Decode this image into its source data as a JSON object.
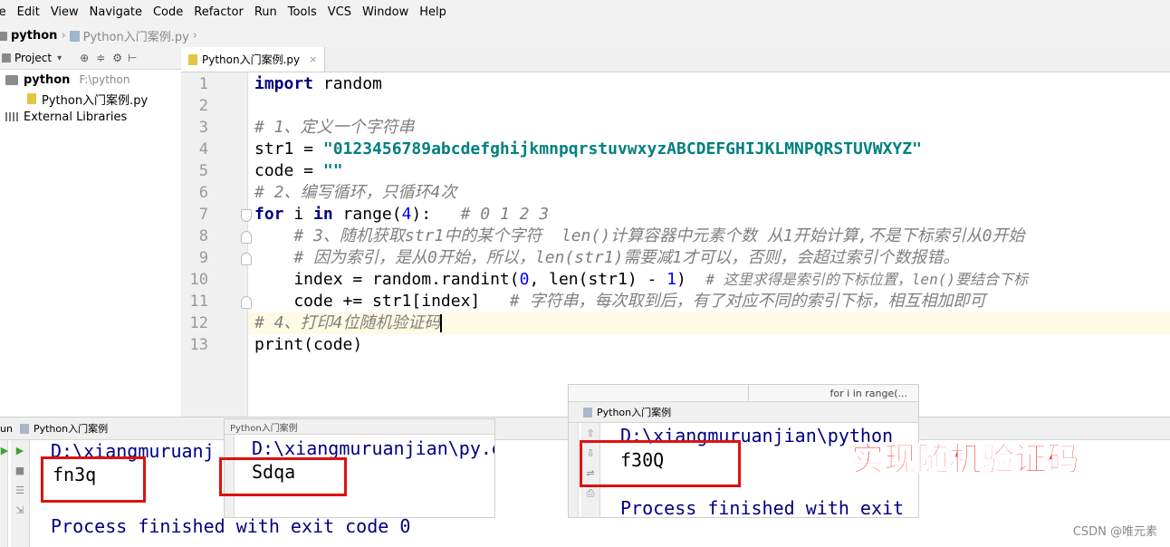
{
  "menu": [
    "le",
    "Edit",
    "View",
    "Navigate",
    "Code",
    "Refactor",
    "Run",
    "Tools",
    "VCS",
    "Window",
    "Help"
  ],
  "nav": {
    "project": "python",
    "file": "Python入门案例.py"
  },
  "project_panel": {
    "header": "Project",
    "root_name": "python",
    "root_path": "F:\\python",
    "file": "Python入门案例.py",
    "libraries": "External Libraries"
  },
  "editor": {
    "tab": "Python入门案例.py",
    "line_numbers": [
      "1",
      "2",
      "3",
      "4",
      "5",
      "6",
      "7",
      "8",
      "9",
      "10",
      "11",
      "12",
      "13"
    ],
    "code": {
      "l1_kw": "import",
      "l1_rest": " random",
      "l3": "# 1、定义一个字符串",
      "l4_a": "str1 = ",
      "l4_str": "\"0123456789abcdefghijkmnpqrstuvwxyzABCDEFGHIJKLMNPQRSTUVWXYZ\"",
      "l5_a": "code = ",
      "l5_str": "\"\"",
      "l6": "# 2、编写循环，只循环4次",
      "l7_kw1": "for",
      "l7_a": " i ",
      "l7_kw2": "in",
      "l7_b": " range(",
      "l7_num": "4",
      "l7_c": "):   ",
      "l7_cmt": "# 0 1 2 3",
      "l8": "    # 3、随机获取str1中的某个字符  len()计算容器中元素个数 从1开始计算,不是下标索引从0开始",
      "l9": "    # 因为索引，是从0开始，所以，len(str1)需要减1才可以，否则，会超过索引个数报错。",
      "l10_a": "    index = random.randint(",
      "l10_n1": "0",
      "l10_b": ", len(str1) - ",
      "l10_n2": "1",
      "l10_c": ")  ",
      "l10_cmt": "# 这里求得是索引的下标位置，len()要结合下标",
      "l11_a": "    code += str1[index]   ",
      "l11_cmt": "# 字符串，每次取到后，有了对应不同的索引下标，相互相加即可",
      "l12": "# 4、打印4位随机验证码",
      "l13": "print(code)"
    }
  },
  "run1": {
    "title": "un",
    "tab": "Python入门案例",
    "path": "D:\\xiangmuruanj",
    "result": "fn3q",
    "footer": "Process finished with exit code 0"
  },
  "run2": {
    "title": "Python入门案例",
    "path": "D:\\xiangmuruanjian\\py",
    "suffix": ".exe F",
    "result": "Sdqa"
  },
  "run3": {
    "title": "Python入门案例",
    "hint": "for i in range(...",
    "path": "D:\\xiangmuruanjian\\python",
    "result": "f30Q",
    "footer": "Process finished with exit"
  },
  "overlay_title": "实现随机验证码",
  "watermark": "CSDN @唯元素",
  "colors": {
    "keyword": "#000080",
    "string": "#008080",
    "comment": "#808080",
    "number": "#0000ff",
    "highlight_box": "#e01010",
    "overlay_text": "#f5241a"
  }
}
